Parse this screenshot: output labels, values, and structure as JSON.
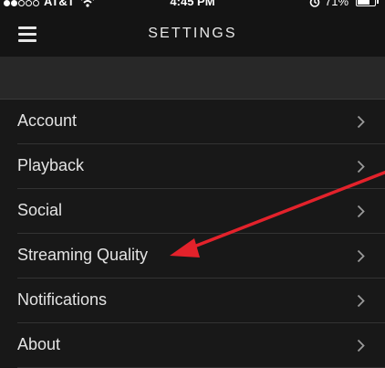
{
  "status_bar": {
    "carrier": "AT&T",
    "time": "4:45 PM",
    "battery": "71%",
    "battery_level": 0.71,
    "signal_bars_full": 2,
    "signal_bars_total": 5
  },
  "nav": {
    "title": "SETTINGS",
    "menu_icon": "hamburger-menu-icon"
  },
  "settings": {
    "items": [
      {
        "label": "Account"
      },
      {
        "label": "Playback"
      },
      {
        "label": "Social"
      },
      {
        "label": "Streaming Quality"
      },
      {
        "label": "Notifications"
      },
      {
        "label": "About"
      }
    ],
    "chevron_icon": "chevron-right-icon"
  },
  "annotation": {
    "type": "arrow",
    "color": "#e3222b",
    "points_to": "Streaming Quality"
  },
  "colors": {
    "background": "#282828",
    "bar": "#141414",
    "list": "#181818",
    "text": "#e3e3e3",
    "arrow": "#e3222b"
  }
}
